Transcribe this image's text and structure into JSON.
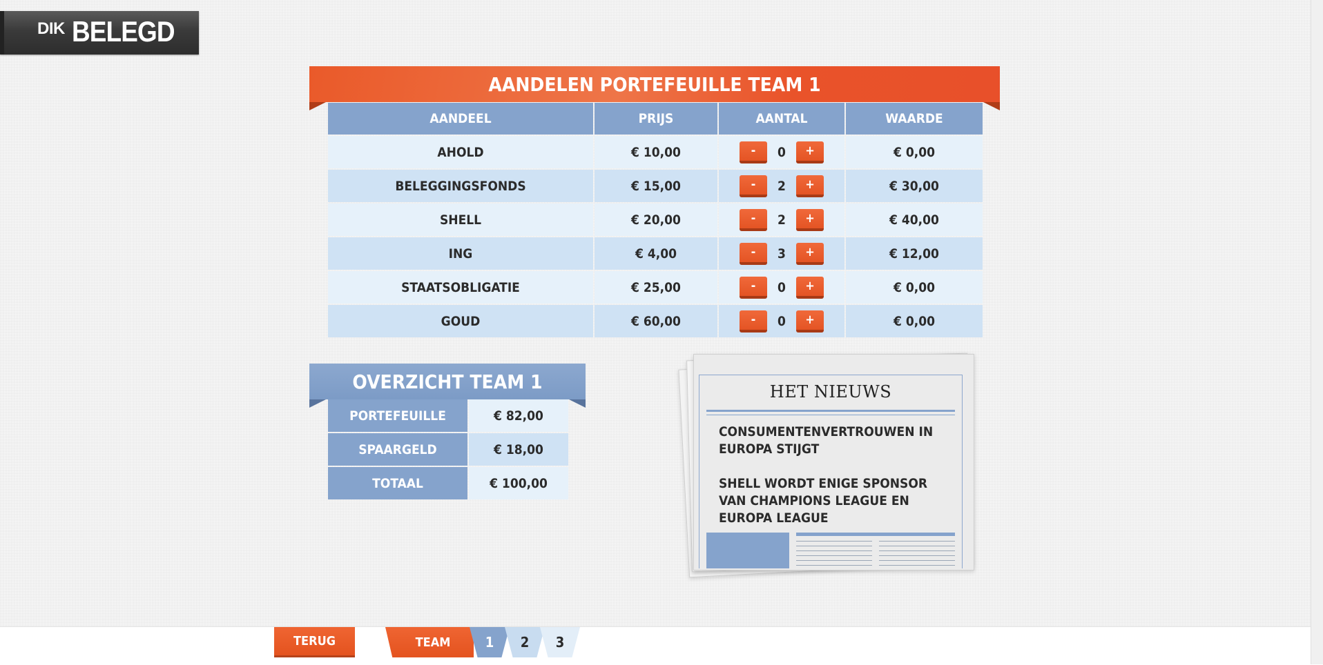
{
  "logo": {
    "small": "DIK",
    "large": "BELEGD"
  },
  "portfolio": {
    "title": "AANDELEN PORTEFEUILLE TEAM 1",
    "columns": [
      "AANDEEL",
      "PRIJS",
      "AANTAL",
      "WAARDE"
    ],
    "minus_label": "-",
    "plus_label": "+",
    "rows": [
      {
        "name": "AHOLD",
        "price": "€ 10,00",
        "qty": "0",
        "value": "€ 0,00"
      },
      {
        "name": "BELEGGINGSFONDS",
        "price": "€ 15,00",
        "qty": "2",
        "value": "€ 30,00"
      },
      {
        "name": "SHELL",
        "price": "€ 20,00",
        "qty": "2",
        "value": "€ 40,00"
      },
      {
        "name": "ING",
        "price": "€ 4,00",
        "qty": "3",
        "value": "€ 12,00"
      },
      {
        "name": "STAATSOBLIGATIE",
        "price": "€ 25,00",
        "qty": "0",
        "value": "€ 0,00"
      },
      {
        "name": "GOUD",
        "price": "€ 60,00",
        "qty": "0",
        "value": "€ 0,00"
      }
    ]
  },
  "overview": {
    "title": "OVERZICHT TEAM 1",
    "rows": [
      {
        "label": "PORTEFEUILLE",
        "value": "€ 82,00"
      },
      {
        "label": "SPAARGELD",
        "value": "€ 18,00"
      },
      {
        "label": "TOTAAL",
        "value": "€ 100,00"
      }
    ]
  },
  "news": {
    "title": "HET NIEUWS",
    "headlines": [
      "CONSUMENTENVERTROUWEN IN EUROPA STIJGT",
      "SHELL WORDT ENIGE SPONSOR VAN CHAMPIONS LEAGUE EN EUROPA LEAGUE"
    ]
  },
  "footer": {
    "back_label": "TERUG",
    "team_label": "TEAM",
    "teams": [
      "1",
      "2",
      "3"
    ],
    "active_team": "1"
  },
  "colors": {
    "accent_orange": "#e9532a",
    "header_blue": "#85a3cc",
    "row_light": "#e6f1fa",
    "row_dark": "#cfe2f4"
  }
}
